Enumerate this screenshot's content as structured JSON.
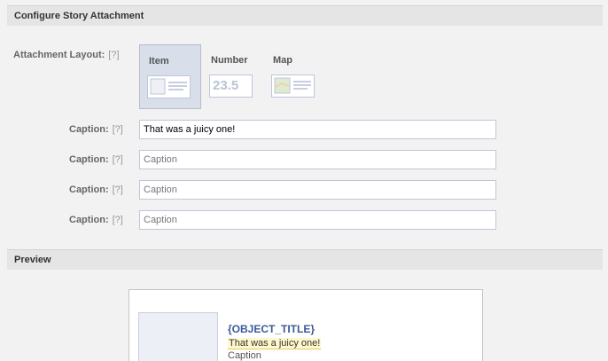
{
  "configure": {
    "title": "Configure Story Attachment",
    "layout_label": "Attachment Layout:",
    "help": "[?]",
    "options": [
      {
        "label": "Item",
        "selected": true
      },
      {
        "label": "Number",
        "thumb_text": "23.5",
        "selected": false
      },
      {
        "label": "Map",
        "selected": false
      }
    ],
    "caption_label": "Caption:",
    "captions": [
      {
        "value": "That was a juicy one!",
        "placeholder": "Caption"
      },
      {
        "value": "",
        "placeholder": "Caption"
      },
      {
        "value": "",
        "placeholder": "Caption"
      },
      {
        "value": "",
        "placeholder": "Caption"
      }
    ]
  },
  "preview": {
    "title": "Preview",
    "object_title": "{OBJECT_TITLE}",
    "caption1": "That was a juicy one!",
    "caption2": "Caption"
  },
  "colors": {
    "background": "#f2f2f2",
    "header": "#e5e5e5",
    "selected": "#d8dfea",
    "link": "#3b5998"
  }
}
